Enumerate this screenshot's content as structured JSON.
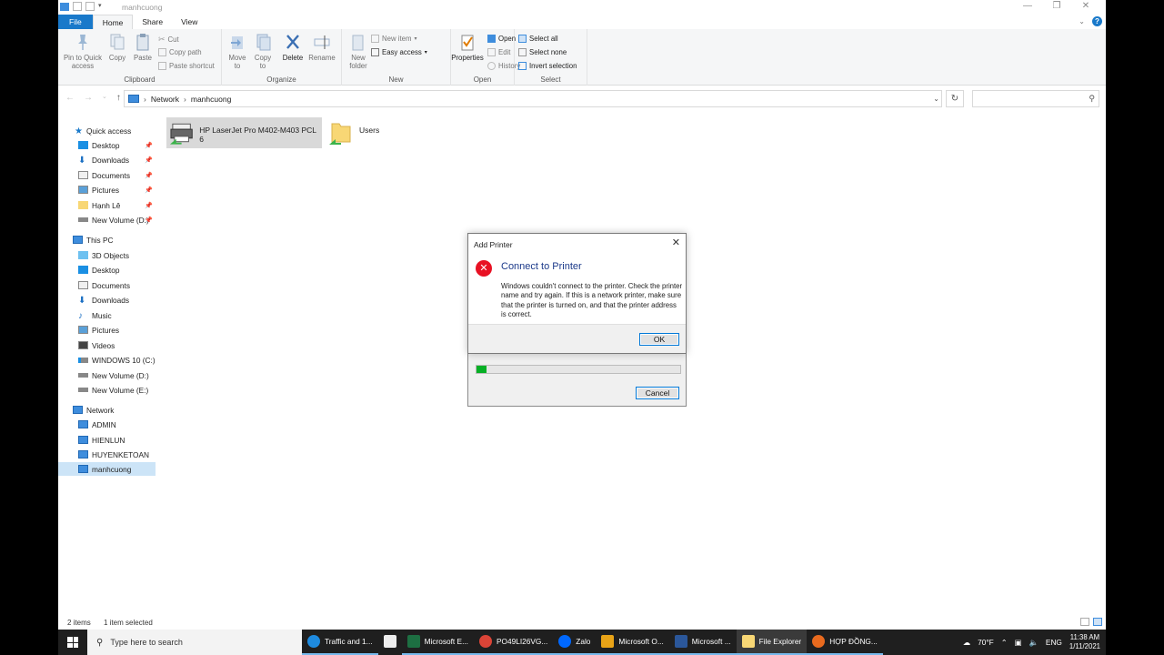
{
  "window": {
    "title": "manhcuong"
  },
  "tabs": [
    "File",
    "Home",
    "Share",
    "View"
  ],
  "ribbon": {
    "clipboard": {
      "name": "Clipboard",
      "pin": "Pin to Quick access",
      "copy": "Copy",
      "paste": "Paste",
      "cut": "Cut",
      "copy_path": "Copy path",
      "paste_shortcut": "Paste shortcut"
    },
    "organize": {
      "name": "Organize",
      "move_to": "Move to",
      "copy_to": "Copy to",
      "delete": "Delete",
      "rename": "Rename"
    },
    "new": {
      "name": "New",
      "new_folder": "New folder",
      "new_item": "New item",
      "easy_access": "Easy access"
    },
    "open": {
      "name": "Open",
      "properties": "Properties",
      "open": "Open",
      "edit": "Edit",
      "history": "History"
    },
    "select": {
      "name": "Select",
      "select_all": "Select all",
      "select_none": "Select none",
      "invert_selection": "Invert selection"
    }
  },
  "address": {
    "crumbs": [
      "Network",
      "manhcuong"
    ]
  },
  "nav": {
    "quick_access": "Quick access",
    "quick_items": [
      "Desktop",
      "Downloads",
      "Documents",
      "Pictures",
      "Hạnh Lê",
      "New Volume (D:)"
    ],
    "this_pc": "This PC",
    "pc_items": [
      "3D Objects",
      "Desktop",
      "Documents",
      "Downloads",
      "Music",
      "Pictures",
      "Videos",
      "WINDOWS 10 (C:)",
      "New Volume (D:)",
      "New Volume (E:)"
    ],
    "network": "Network",
    "network_items": [
      "ADMIN",
      "HIENLUN",
      "HUYENKETOAN",
      "manhcuong"
    ]
  },
  "files": [
    {
      "name": "HP LaserJet Pro M402-M403 PCL 6"
    },
    {
      "name": "Users"
    }
  ],
  "status": {
    "count": "2 items",
    "selected": "1 item selected"
  },
  "dialog": {
    "title": "Add Printer",
    "heading": "Connect to Printer",
    "message": "Windows couldn't connect to the printer. Check the printer name and try again. If this is a network printer, make sure that the printer is turned on, and that the printer address is correct.",
    "ok": "OK"
  },
  "progress_dialog": {
    "cancel": "Cancel",
    "progress": 0.05
  },
  "taskbar": {
    "search_placeholder": "Type here to search",
    "items": [
      "Traffic and 1...",
      "Microsoft E...",
      "PO49LI26VG...",
      "Zalo",
      "Microsoft O...",
      "Microsoft ...",
      "File Explorer",
      "HỢP ĐỒNG..."
    ],
    "weather": "70°F",
    "lang": "ENG",
    "time": "11:38 AM",
    "date": "1/11/2021"
  },
  "colors": {
    "accent": "#1979ca",
    "selection": "#cce4f7",
    "error": "#e81123",
    "progress": "#06b025"
  }
}
